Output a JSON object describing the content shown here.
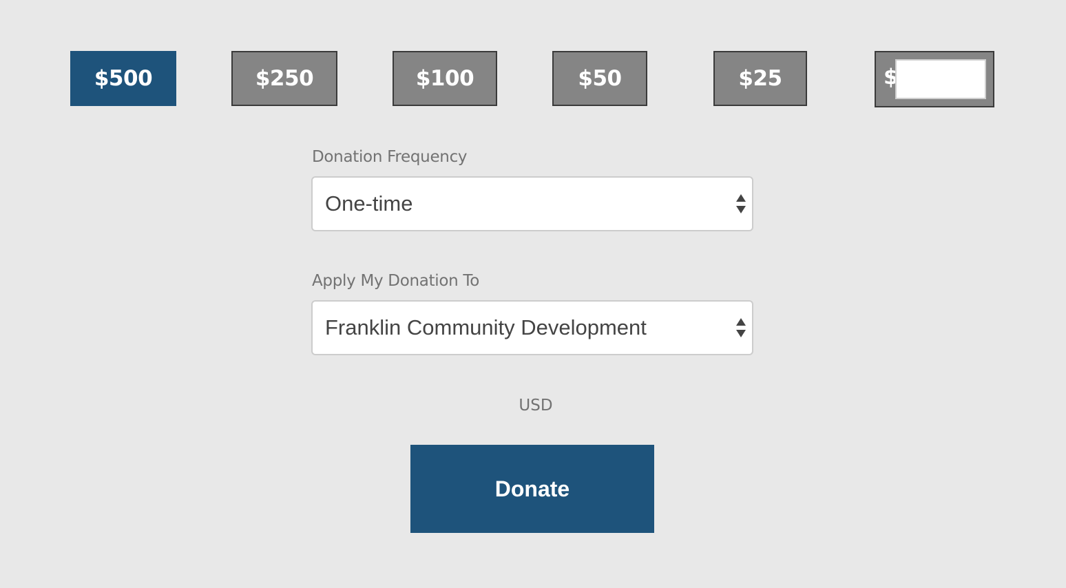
{
  "amounts": [
    {
      "label": "$500",
      "selected": true
    },
    {
      "label": "$250",
      "selected": false
    },
    {
      "label": "$100",
      "selected": false
    },
    {
      "label": "$50",
      "selected": false
    },
    {
      "label": "$25",
      "selected": false
    }
  ],
  "custom_amount": {
    "currency_symbol": "$",
    "value": ""
  },
  "frequency": {
    "label": "Donation Frequency",
    "selected": "One-time"
  },
  "designation": {
    "label": "Apply My Donation To",
    "selected": "Franklin Community Development"
  },
  "currency": "USD",
  "donate_label": "Donate",
  "colors": {
    "background": "#e8e8e8",
    "selected_amount": "#1e537b",
    "unselected_amount": "#858585",
    "donate_button": "#1e537b"
  }
}
